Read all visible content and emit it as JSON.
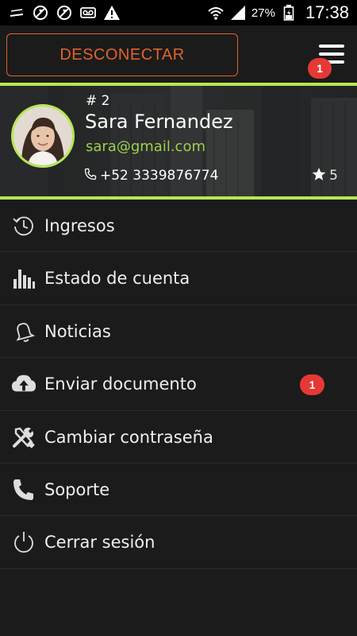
{
  "status_bar": {
    "icons_left": [
      "no-signal-icon",
      "no-sync-icon",
      "no-sync-icon",
      "voicemail-icon",
      "warning-icon"
    ],
    "icons_right": [
      "wifi-icon",
      "signal-icon",
      "battery-icon"
    ],
    "battery": "27%",
    "time": "17:38"
  },
  "top_bar": {
    "disconnect_label": "DESCONECTAR",
    "menu_icon": "hamburger-icon",
    "menu_badge": "1"
  },
  "profile": {
    "number": "# 2",
    "name": "Sara Fernandez",
    "email": "sara@gmail.com",
    "phone": "+52 3339876774",
    "rating": "5",
    "accent_color": "#b5e853"
  },
  "menu": {
    "items": [
      {
        "label": "Ingresos",
        "icon": "history-icon"
      },
      {
        "label": "Estado de cuenta",
        "icon": "bar-chart-icon"
      },
      {
        "label": "Noticias",
        "icon": "bell-icon"
      },
      {
        "label": "Enviar documento",
        "icon": "cloud-upload-icon",
        "badge": "1"
      },
      {
        "label": "Cambiar contraseña",
        "icon": "tools-icon"
      },
      {
        "label": "Soporte",
        "icon": "phone-icon"
      },
      {
        "label": "Cerrar sesión",
        "icon": "power-icon"
      }
    ]
  },
  "colors": {
    "background": "#1b1b1b",
    "accent_green": "#b5e853",
    "email_green": "#9bd24b",
    "orange": "#e0632a",
    "badge_red": "#e53935"
  }
}
